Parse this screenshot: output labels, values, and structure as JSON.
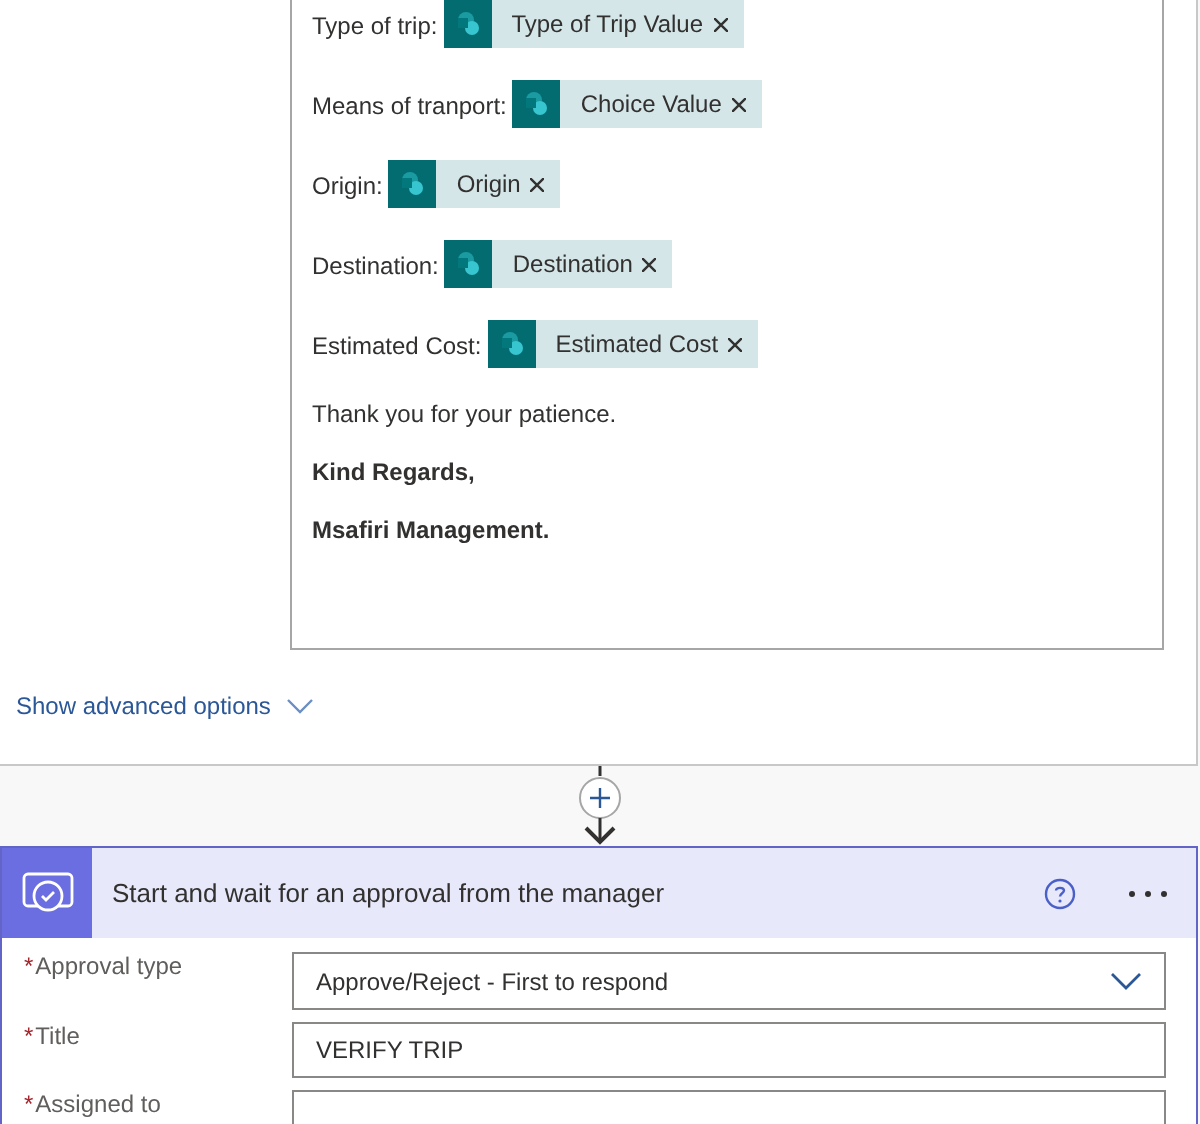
{
  "email_body": {
    "fields": [
      {
        "label": "Type of trip:",
        "token": "Type of Trip Value"
      },
      {
        "label": "Means of tranport:",
        "token": "Choice Value"
      },
      {
        "label": "Origin:",
        "token": "Origin"
      },
      {
        "label": "Destination:",
        "token": "Destination"
      },
      {
        "label": "Estimated Cost:",
        "token": "Estimated Cost"
      }
    ],
    "closing_lines": [
      {
        "text": "Thank you for your patience.",
        "bold": false
      },
      {
        "text": "Kind Regards,",
        "bold": true
      },
      {
        "text": "Msafiri Management.",
        "bold": true
      }
    ]
  },
  "advanced_options_link": "Show advanced options",
  "approval_card": {
    "title": "Start and wait for an approval from the manager",
    "fields": [
      {
        "label": "Approval type",
        "required_mark": "*",
        "kind": "dropdown",
        "value": "Approve/Reject - First to respond"
      },
      {
        "label": "Title",
        "required_mark": "*",
        "kind": "text",
        "value": "VERIFY TRIP"
      },
      {
        "label": "Assigned to",
        "required_mark": "*",
        "kind": "text"
      }
    ]
  }
}
